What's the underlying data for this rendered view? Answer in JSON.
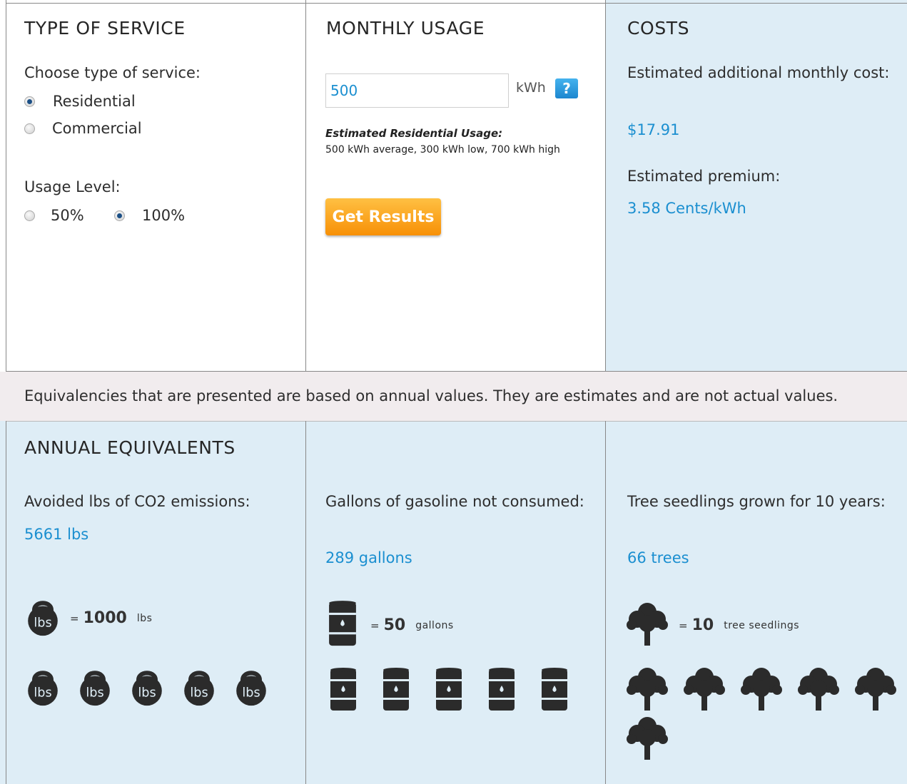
{
  "type_of_service": {
    "heading": "TYPE OF SERVICE",
    "choose_label": "Choose type of service:",
    "options": [
      {
        "label": "Residential",
        "selected": true
      },
      {
        "label": "Commercial",
        "selected": false
      }
    ],
    "usage_level_label": "Usage Level:",
    "usage_levels": [
      {
        "label": "50%",
        "selected": false
      },
      {
        "label": "100%",
        "selected": true
      }
    ]
  },
  "monthly_usage": {
    "heading": "MONTHLY USAGE",
    "input_value": "500",
    "unit": "kWh",
    "help_label": "?",
    "estimate_title": "Estimated Residential Usage:",
    "estimate_detail": "500 kWh average, 300 kWh low, 700 kWh high",
    "button_label": "Get Results"
  },
  "costs": {
    "heading": "COSTS",
    "monthly_label": "Estimated additional monthly cost:",
    "monthly_value": "$17.91",
    "premium_label": "Estimated premium:",
    "premium_value": "3.58 Cents/kWh"
  },
  "banner_text": "Equivalencies that are presented are based on annual values. They are estimates and are not actual values.",
  "annual": {
    "heading": "ANNUAL EQUIVALENTS",
    "co2": {
      "label": "Avoided lbs of CO2 emissions:",
      "value": "5661 lbs",
      "legend_eq": "=",
      "legend_num": "1000",
      "legend_unit": "lbs",
      "icon_text": "lbs",
      "icon_count": 5,
      "icon": "kettlebell-icon"
    },
    "gas": {
      "label": "Gallons of gasoline not consumed:",
      "value": "289 gallons",
      "legend_eq": "=",
      "legend_num": "50",
      "legend_unit": "gallons",
      "icon_count": 5,
      "icon": "oil-barrel-icon"
    },
    "trees": {
      "label": "Tree seedlings grown for 10 years:",
      "value": "66 trees",
      "legend_eq": "=",
      "legend_num": "10",
      "legend_unit": "tree seedlings",
      "icon_count": 6,
      "icon": "tree-icon"
    }
  },
  "colors": {
    "accent": "#1b8fd0",
    "panel_blue": "#deedf6",
    "banner": "#f1ecee",
    "button_orange": "#f79006",
    "icon_dark": "#2b2b2b"
  }
}
